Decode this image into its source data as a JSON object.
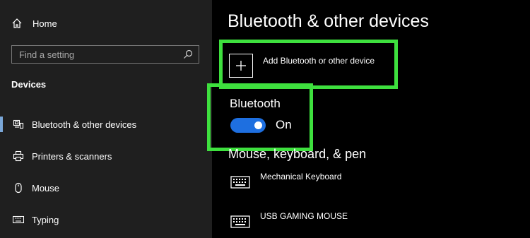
{
  "sidebar": {
    "home_label": "Home",
    "search_placeholder": "Find a setting",
    "section_title": "Devices",
    "items": [
      {
        "label": "Bluetooth & other devices",
        "icon": "bluetooth-devices-icon",
        "active": true
      },
      {
        "label": "Printers & scanners",
        "icon": "printer-icon",
        "active": false
      },
      {
        "label": "Mouse",
        "icon": "mouse-icon",
        "active": false
      },
      {
        "label": "Typing",
        "icon": "keyboard-icon",
        "active": false
      }
    ]
  },
  "main": {
    "title": "Bluetooth & other devices",
    "add_device_label": "Add Bluetooth or other device",
    "bluetooth": {
      "heading": "Bluetooth",
      "state_label": "On",
      "enabled": true
    },
    "section_heading": "Mouse, keyboard, & pen",
    "devices": [
      {
        "name": "Mechanical Keyboard",
        "icon": "keyboard-icon"
      },
      {
        "name": "USB GAMING MOUSE",
        "icon": "keyboard-icon"
      }
    ]
  },
  "colors": {
    "highlight": "#3ee03e",
    "toggle_on": "#1e6fe0",
    "sidebar_bg": "#1f1f1f",
    "main_bg": "#000000"
  }
}
